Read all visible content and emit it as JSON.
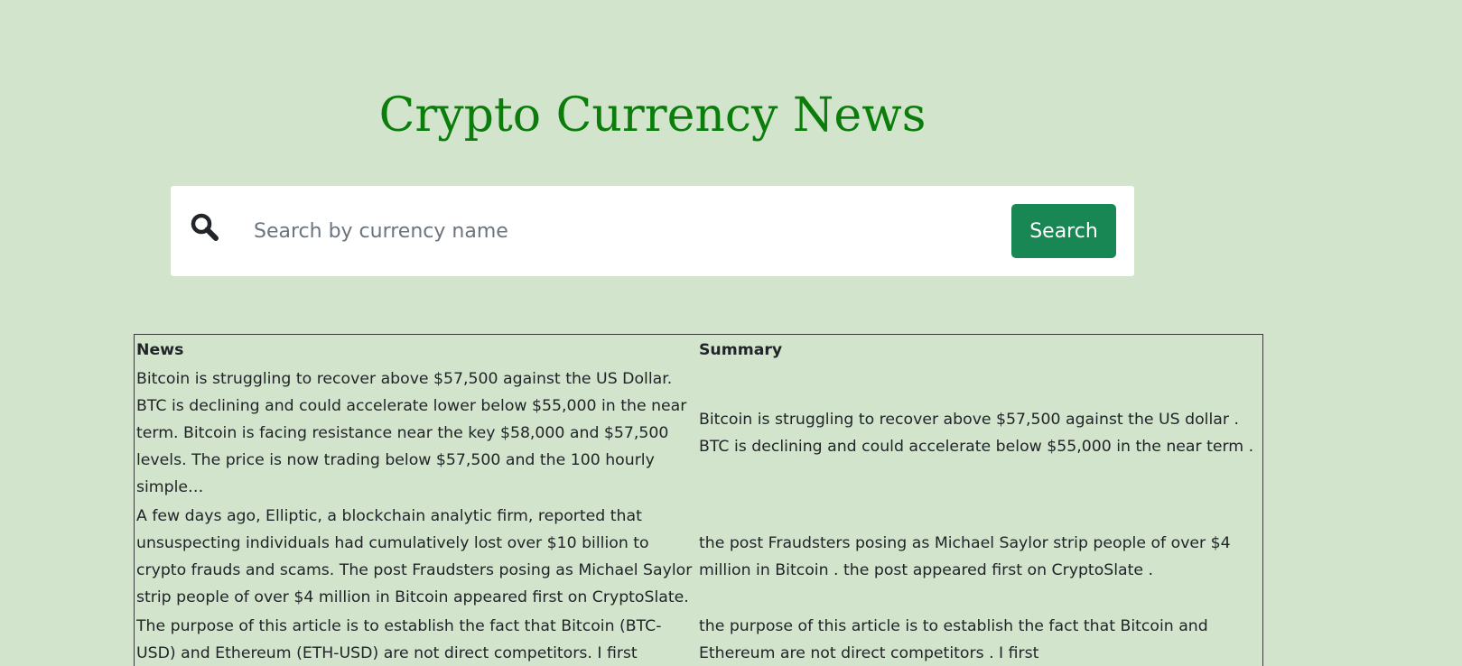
{
  "page": {
    "title": "Crypto Currency News"
  },
  "search": {
    "icon": "search-icon",
    "placeholder": "Search by currency name",
    "value": "",
    "button_label": "Search",
    "button_color": "#198754"
  },
  "table": {
    "headers": {
      "news": "News",
      "summary": "Summary"
    },
    "rows": [
      {
        "news": "Bitcoin is struggling to recover above $57,500 against the US Dollar. BTC is declining and could accelerate lower below $55,000 in the near term. Bitcoin is facing resistance near the key $58,000 and $57,500 levels. The price is now trading below $57,500 and the 100 hourly simple…",
        "summary": "Bitcoin is struggling to recover above $57,500 against the US dollar . BTC is declining and could accelerate below $55,000 in the near term ."
      },
      {
        "news": "A few days ago, Elliptic, a blockchain analytic firm, reported that unsuspecting individuals had cumulatively lost over $10 billion to crypto frauds and scams. The post Fraudsters posing as Michael Saylor strip people of over $4 million in Bitcoin appeared first on CryptoSlate.",
        "summary": "the post Fraudsters posing as Michael Saylor strip people of over $4 million in Bitcoin . the post appeared first on CryptoSlate ."
      },
      {
        "news": "The purpose of this article is to establish the fact that Bitcoin (BTC-USD) and Ethereum (ETH-USD) are not direct competitors. I first",
        "summary": "the purpose of this article is to establish the fact that Bitcoin and Ethereum are not direct competitors . I first"
      }
    ]
  },
  "colors": {
    "background": "#d2e4cc",
    "title": "#0b7d0b"
  }
}
